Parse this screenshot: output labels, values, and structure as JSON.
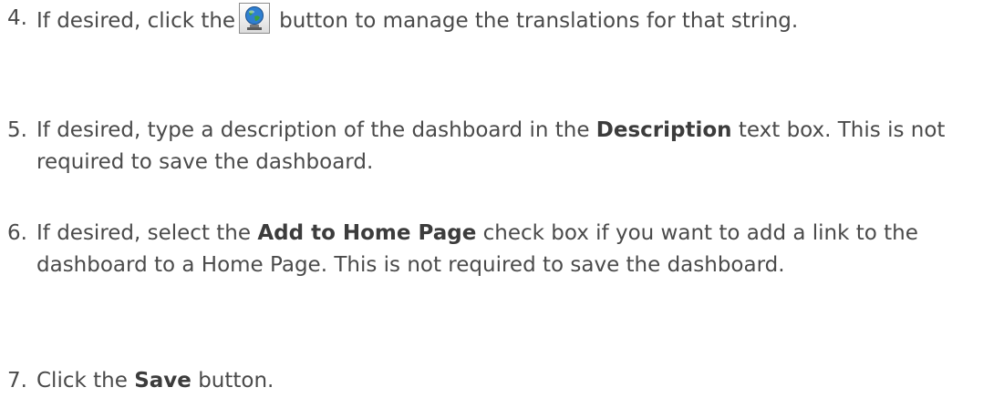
{
  "steps": [
    {
      "number": "4.",
      "text_before": "If desired, click the",
      "icon": "globe-translation-icon",
      "text_after": "button to manage the translations for that string."
    },
    {
      "number": "5.",
      "text_before": "If desired, type a description of the dashboard in the",
      "bold": "Description",
      "text_after": "text box. This is not required to save the dashboard."
    },
    {
      "number": "6.",
      "text_before": "If desired, select the",
      "bold": "Add to Home Page",
      "text_after": "check box if you want to add a link to the dashboard to a Home Page. This is not required to save the dashboard."
    },
    {
      "number": "7.",
      "text_before": "Click the",
      "bold": "Save",
      "text_after": "button."
    }
  ],
  "colors": {
    "text": "#4a4a4a",
    "globe_blue": "#2f7fd0",
    "globe_green": "#3aa13a"
  }
}
